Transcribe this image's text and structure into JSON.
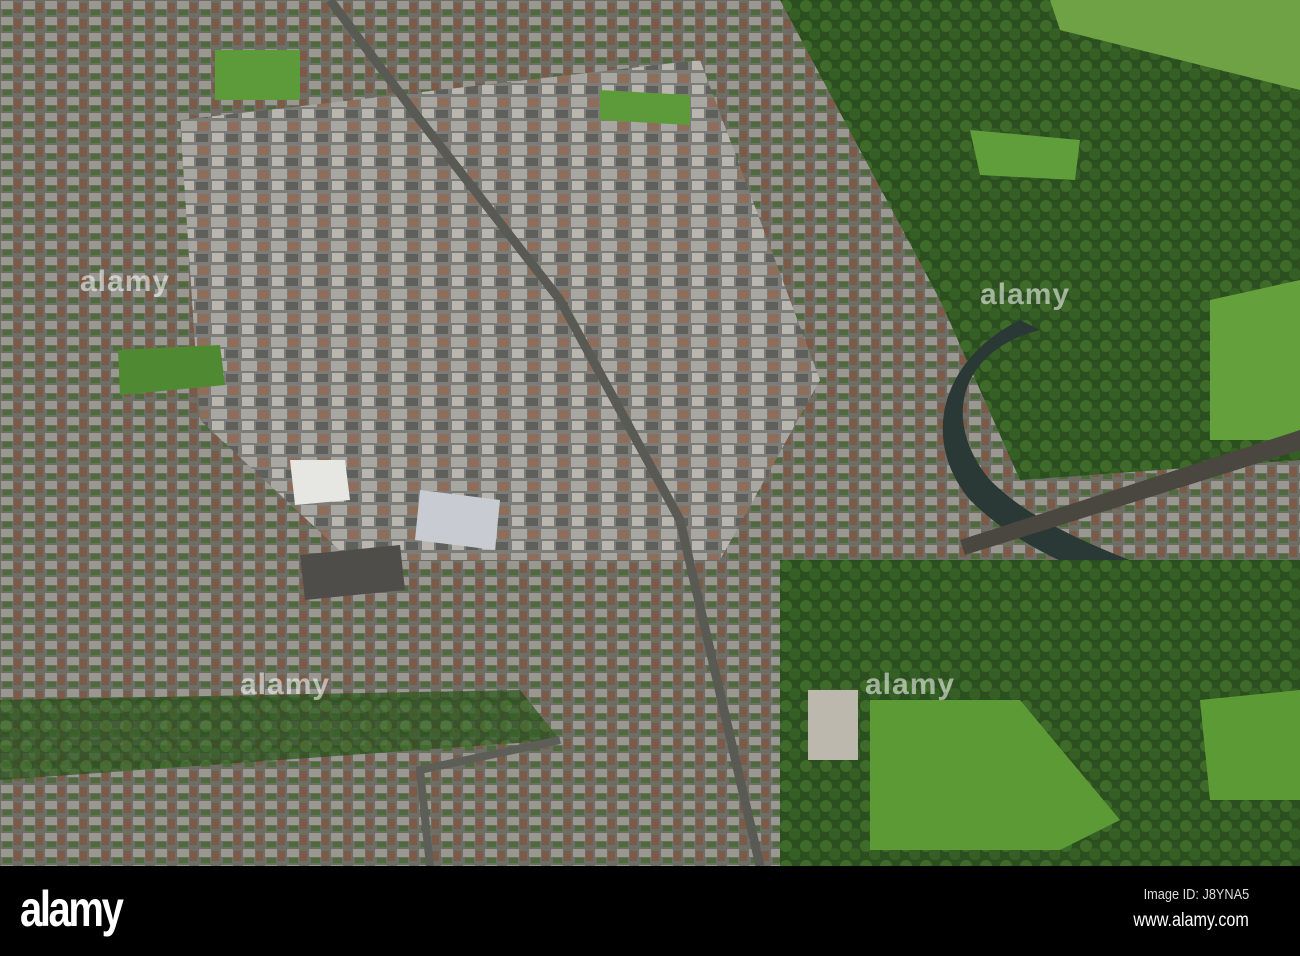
{
  "photo": {
    "subject": "aerial view of town",
    "colors": {
      "grass": "#5f9a3a",
      "trees": "#2f5a22",
      "roofs": "#8c8a86",
      "river": "#2d3a36"
    }
  },
  "watermarks": [
    "alamy",
    "alamy",
    "alamy",
    "alamy"
  ],
  "footer": {
    "logo": "alamy",
    "image_id": "Image ID: J8YNA5",
    "website": "www.alamy.com"
  }
}
